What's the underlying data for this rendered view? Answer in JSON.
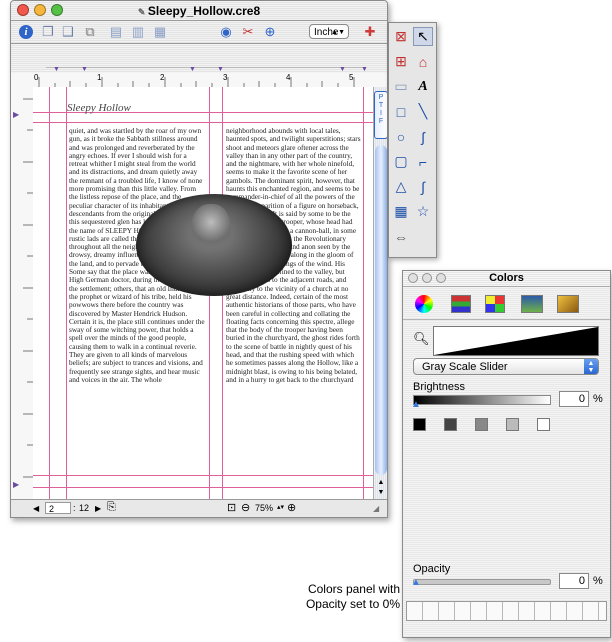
{
  "window": {
    "title": "Sleepy_Hollow.cre8",
    "unit_selected": "Inche",
    "ruler_marks": [
      "0",
      "1",
      "2",
      "3",
      "4",
      "5"
    ],
    "page_heading": "Sleepy Hollow",
    "page_current": "2",
    "page_total": "12",
    "page_sep": ":",
    "zoom": "75%",
    "columns": [
      "quiet, and was startled by the roar of my own gun, as it broke the Sabbath stillness around and was prolonged and reverberated by the angry echoes. If ever I should wish for a retreat whither I might steal from the world and its distractions, and dream quietly away the remnant of a troubled life, I know of none more promising than this little valley. From the listless repose of the place, and the peculiar character of its inhabitants, who are descendants from the original Dutch settlers, this sequestered glen has long been known by the name of SLEEPY HOLLOW, and its rustic lads are called the Sleepy Hollow Boys throughout all the neighboring country. A drowsy, dreamy influence seems to hang over the land, and to pervade the very atmosphere. Some say that the place was bewitched by a High German doctor, during the early days of the settlement; others, that an old Indian chief, the prophet or wizard of his tribe, held his powwows there before the country was discovered by Master Hendrick Hudson. Certain it is, the place still continues under the sway of some witching power, that holds a spell over the minds of the good people, causing them to walk in a continual reverie. They are given to all kinds of marvelous beliefs; are subject to trances and visions, and frequently see strange sights, and hear music and voices in the air. The whole",
      "neighborhood abounds with local tales, haunted spots, and twilight superstitions; stars shoot and meteors glare oftener across the valley than in any other part of the country, and the nightmare, with her whole ninefold, seems to make it the favorite scene of her gambols. The dominant spirit, however, that haunts this enchanted region, and seems to be commander-in-chief of all the powers of the air, is the apparition of a figure on horseback, without a head. It is said by some to be the ghost of a Hessian trooper, whose head had been carried away by a cannon-ball, in some nameless battle during the Revolutionary War, and who is ever and anon seen by the country folk hurrying along in the gloom of night, as if on the wings of the wind. His haunts are not confined to the valley, but extend at times to the adjacent roads, and especially to the vicinity of a church at no great distance. Indeed, certain of the most authentic historians of those parts, who have been careful in collecting and collating the floating facts concerning this spectre, allege that the body of the trooper having been buried in the churchyard, the ghost rides forth to the scene of battle in nightly quest of his head, and that the rushing speed with which he sometimes passes along the Hollow, like a midnight blast, is owing to his being belated, and in a hurry to get back to the churchyard"
    ]
  },
  "colors_panel": {
    "title": "Colors",
    "mode_selected": "Gray Scale Slider",
    "brightness_label": "Brightness",
    "brightness_value": "0",
    "percent": "%",
    "opacity_label": "Opacity",
    "opacity_value": "0",
    "swatch_grays": [
      "#000000",
      "#444444",
      "#888888",
      "#bbbbbb",
      "#ffffff"
    ]
  },
  "caption": {
    "line1": "Colors panel with",
    "line2": "Opacity set to 0%"
  },
  "accent": {
    "margin_guide": "#e0609a",
    "traffic_red": "#f2574b",
    "traffic_yellow": "#f6b73c",
    "traffic_green": "#56c047",
    "aqua_blue": "#3a7be0"
  }
}
